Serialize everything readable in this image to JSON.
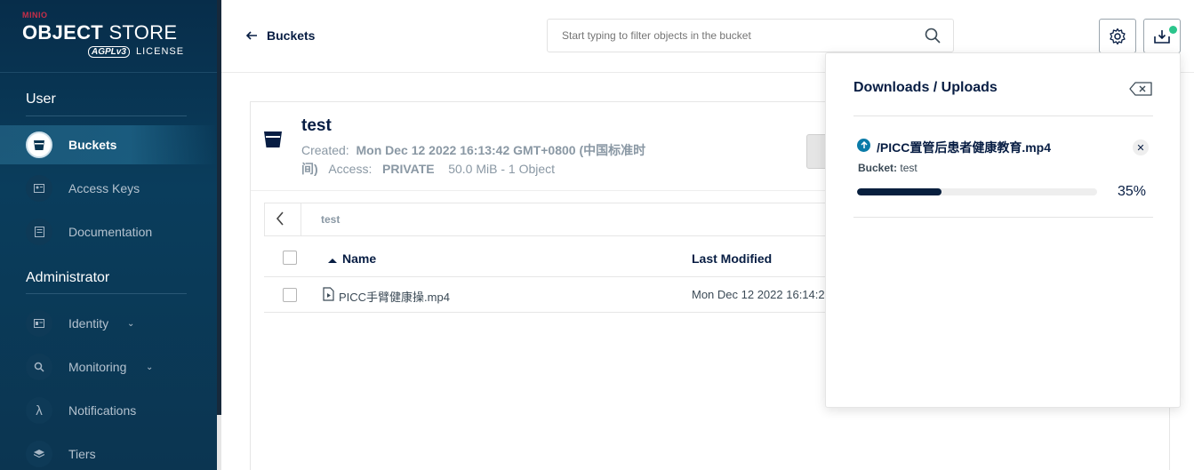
{
  "brand": {
    "small": "MINIO",
    "title_bold": "OBJECT",
    "title_light": " STORE",
    "agpl": "AGPLv3",
    "license": "LICENSE"
  },
  "sidebar": {
    "sections": [
      {
        "label": "User"
      },
      {
        "label": "Administrator"
      }
    ],
    "items": [
      {
        "label": "Buckets",
        "icon": "bucket-icon",
        "active": true
      },
      {
        "label": "Access Keys",
        "icon": "key-icon"
      },
      {
        "label": "Documentation",
        "icon": "doc-icon"
      },
      {
        "label": "Identity",
        "icon": "identity-icon",
        "chevron": "⌄"
      },
      {
        "label": "Monitoring",
        "icon": "monitoring-icon",
        "chevron": "⌄"
      },
      {
        "label": "Notifications",
        "icon": "lambda-icon",
        "glyph": "λ"
      },
      {
        "label": "Tiers",
        "icon": "tiers-icon"
      }
    ]
  },
  "topbar": {
    "back_label": "Buckets",
    "search_placeholder": "Start typing to filter objects in the bucket"
  },
  "bucket": {
    "name": "test",
    "created_label": "Created:",
    "created_value": "Mon Dec 12 2022 16:13:42 GMT+0800 (中国标准时间)",
    "access_label": "Access:",
    "access_value": "PRIVATE",
    "size": "50.0 MiB - 1 Object"
  },
  "browser": {
    "path": "test",
    "columns": {
      "name": "Name",
      "last_modified": "Last Modified"
    },
    "rows": [
      {
        "name": "PICC手臂健康操.mp4",
        "last_modified": "Mon Dec 12 2022 16:14:2"
      }
    ]
  },
  "downloads_panel": {
    "title": "Downloads / Uploads",
    "item": {
      "file": "/PICC置管后患者健康教育.mp4",
      "bucket_label": "Bucket:",
      "bucket_value": "test",
      "progress": 0.35,
      "progress_label": "35%"
    }
  },
  "colors": {
    "accent": "#081f3e",
    "sidebar": "#0b3551",
    "notify_dot": "#2bc58c",
    "upload_icon": "#0a7ba8"
  }
}
